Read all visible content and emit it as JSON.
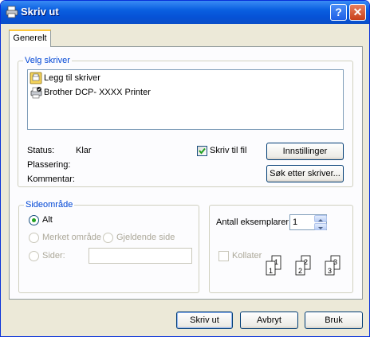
{
  "window": {
    "title": "Skriv ut",
    "help_glyph": "?",
    "close_glyph": "✕"
  },
  "tabs": [
    {
      "label": "Generelt",
      "active": true
    }
  ],
  "printer_group": {
    "legend": "Velg skriver",
    "items": [
      {
        "label": "Legg til skriver",
        "icon": "add-printer-icon"
      },
      {
        "label": "Brother DCP- XXXX    Printer",
        "icon": "printer-default-icon"
      }
    ]
  },
  "status": {
    "status_label": "Status:",
    "status_value": "Klar",
    "location_label": "Plassering:",
    "comment_label": "Kommentar:"
  },
  "print_to_file": {
    "label": "Skriv til fil",
    "checked": true
  },
  "buttons": {
    "preferences": "Innstillinger",
    "find_printer": "Søk etter skriver...",
    "print": "Skriv ut",
    "cancel": "Avbryt",
    "apply": "Bruk"
  },
  "page_range": {
    "legend": "Sideområde",
    "all": "Alt",
    "selection": "Merket område",
    "current": "Gjeldende side",
    "pages": "Sider:",
    "pages_value": ""
  },
  "copies": {
    "label": "Antall eksemplarer:",
    "value": "1",
    "collate_label": "Kollater",
    "collate_checked": false,
    "page_numbers": [
      "1",
      "1",
      "2",
      "2",
      "3",
      "3"
    ]
  },
  "colors": {
    "title_bar": "#0a5fe0",
    "group_legend": "#0046d5",
    "radio_dot": "#21a121"
  }
}
